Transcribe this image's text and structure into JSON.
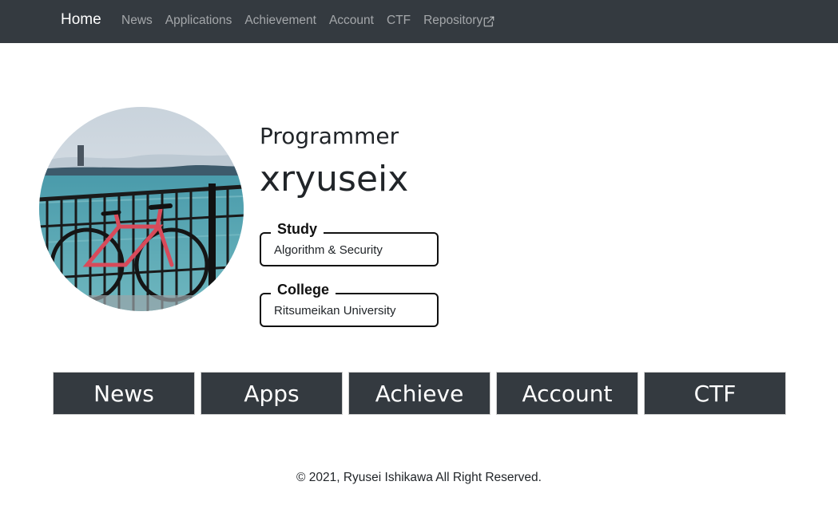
{
  "navbar": {
    "brand": "Home",
    "items": [
      "News",
      "Applications",
      "Achievement",
      "Account",
      "CTF",
      "Repository"
    ],
    "external_icon": "external-link-icon"
  },
  "profile": {
    "avatar_alt": "profile photo: bicycle by the lake",
    "subtitle": "Programmer",
    "handle": "xryuseix",
    "fields": [
      {
        "label": "Study",
        "value": "Algorithm & Security"
      },
      {
        "label": "College",
        "value": "Ritsumeikan University"
      }
    ]
  },
  "tiles": [
    "News",
    "Apps",
    "Achieve",
    "Account",
    "CTF"
  ],
  "footer": {
    "text": "© 2021, Ryusei Ishikawa All Right Reserved."
  },
  "colors": {
    "navbar_bg": "#343a40",
    "tile_bg": "#343a40"
  }
}
